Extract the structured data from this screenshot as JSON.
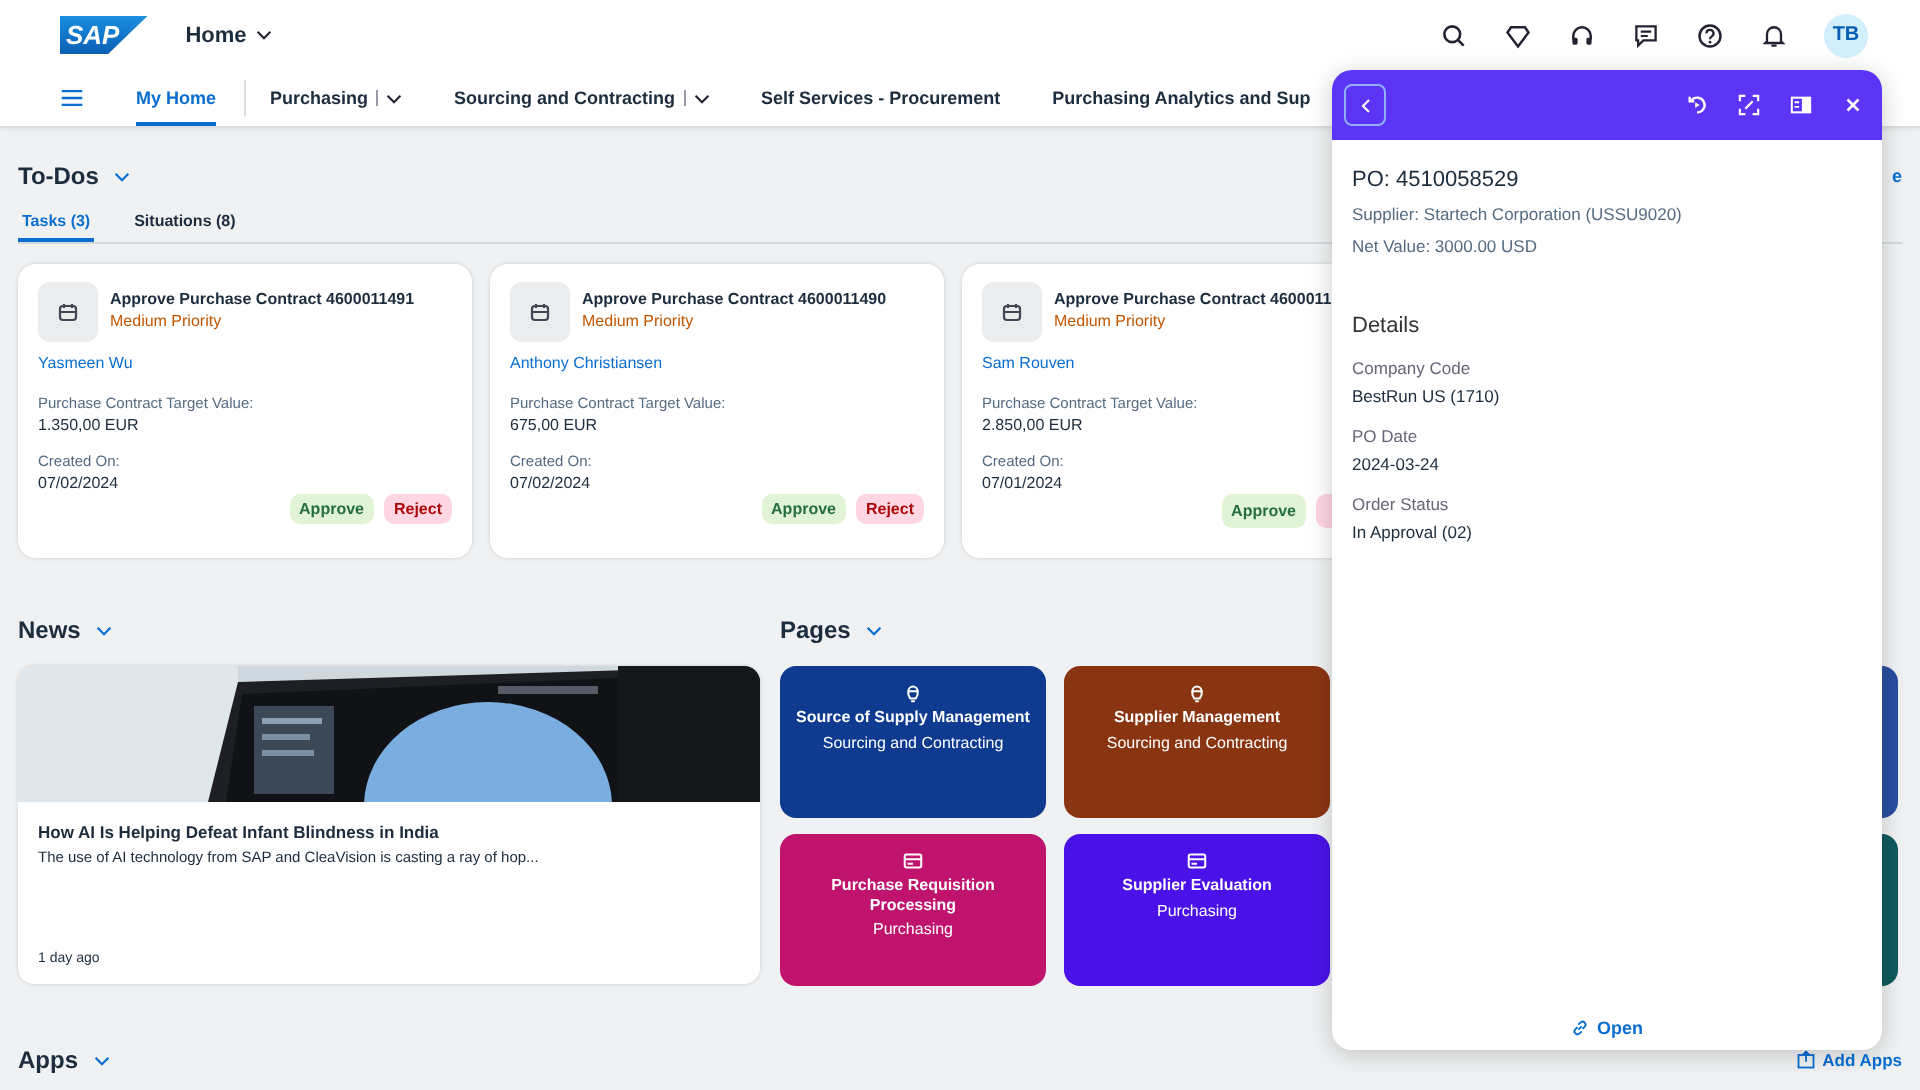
{
  "header": {
    "logo": "SAP",
    "title": "Home",
    "avatar": "TB"
  },
  "nav": {
    "items": [
      {
        "label": "My Home",
        "selected": true,
        "menu": false
      },
      {
        "label": "Purchasing",
        "selected": false,
        "menu": true
      },
      {
        "label": "Sourcing and Contracting",
        "selected": false,
        "menu": true
      },
      {
        "label": "Self Services - Procurement",
        "selected": false,
        "menu": false
      },
      {
        "label": "Purchasing Analytics and Sup",
        "selected": false,
        "menu": false
      }
    ]
  },
  "todos": {
    "title": "To-Dos",
    "link": "e",
    "tabs": [
      {
        "label": "Tasks (3)",
        "selected": true
      },
      {
        "label": "Situations (8)",
        "selected": false
      }
    ],
    "cards": [
      {
        "title": "Approve Purchase Contract 4600011491",
        "priority": "Medium Priority",
        "person": "Yasmeen Wu",
        "value_label": "Purchase Contract Target Value:",
        "value": "1.350,00 EUR",
        "date_label": "Created On:",
        "date": "07/02/2024",
        "actions": [
          {
            "label": "Approve",
            "kind": "approve"
          },
          {
            "label": "Reject",
            "kind": "reject"
          }
        ]
      },
      {
        "title": "Approve Purchase Contract 4600011490",
        "priority": "Medium Priority",
        "person": "Anthony Christiansen",
        "value_label": "Purchase Contract Target Value:",
        "value": "675,00 EUR",
        "date_label": "Created On:",
        "date": "07/02/2024",
        "actions": [
          {
            "label": "Approve",
            "kind": "approve"
          },
          {
            "label": "Reject",
            "kind": "reject"
          }
        ]
      },
      {
        "title": "Approve Purchase Contract 4600011",
        "priority": "Medium Priority",
        "person": "Sam Rouven",
        "value_label": "Purchase Contract Target Value:",
        "value": "2.850,00 EUR",
        "date_label": "Created On:",
        "date": "07/01/2024",
        "actions": [
          {
            "label": "Approve",
            "kind": "approve"
          },
          {
            "kind": "reject"
          }
        ]
      }
    ]
  },
  "news": {
    "title": "News",
    "headline": "How AI Is Helping Defeat Infant Blindness in India",
    "summary": "The use of AI technology from SAP and CleaVision is casting a ray of hop...",
    "age": "1 day ago"
  },
  "pages": {
    "title": "Pages",
    "tiles": [
      {
        "kind": "person",
        "title": "Source of Supply Management",
        "subtitle": "Sourcing and Contracting",
        "color": "#0e3a8f"
      },
      {
        "kind": "person",
        "title": "Supplier Management",
        "subtitle": "Sourcing and Contracting",
        "color": "#8a3512"
      },
      {
        "kind": "partial",
        "color": "#2a4fa0"
      },
      {
        "kind": "card",
        "title": "Purchase Requisition Processing",
        "subtitle": "Purchasing",
        "color": "#c0136e"
      },
      {
        "kind": "card",
        "title": "Supplier Evaluation",
        "subtitle": "Purchasing",
        "color": "#4a12e8"
      },
      {
        "kind": "partial",
        "color": "#0f5a5e"
      }
    ]
  },
  "apps": {
    "title": "Apps",
    "add_label": "Add Apps"
  },
  "panel": {
    "title": "PO: 4510058529",
    "lines": [
      "Supplier: Startech Corporation (USSU9020)",
      "Net Value: 3000.00 USD"
    ],
    "section": "Details",
    "fields": [
      {
        "label": "Company Code",
        "value": "BestRun US (1710)"
      },
      {
        "label": "PO Date",
        "value": "2024-03-24"
      },
      {
        "label": "Order Status",
        "value": "In Approval (02)"
      }
    ],
    "open": "Open"
  }
}
